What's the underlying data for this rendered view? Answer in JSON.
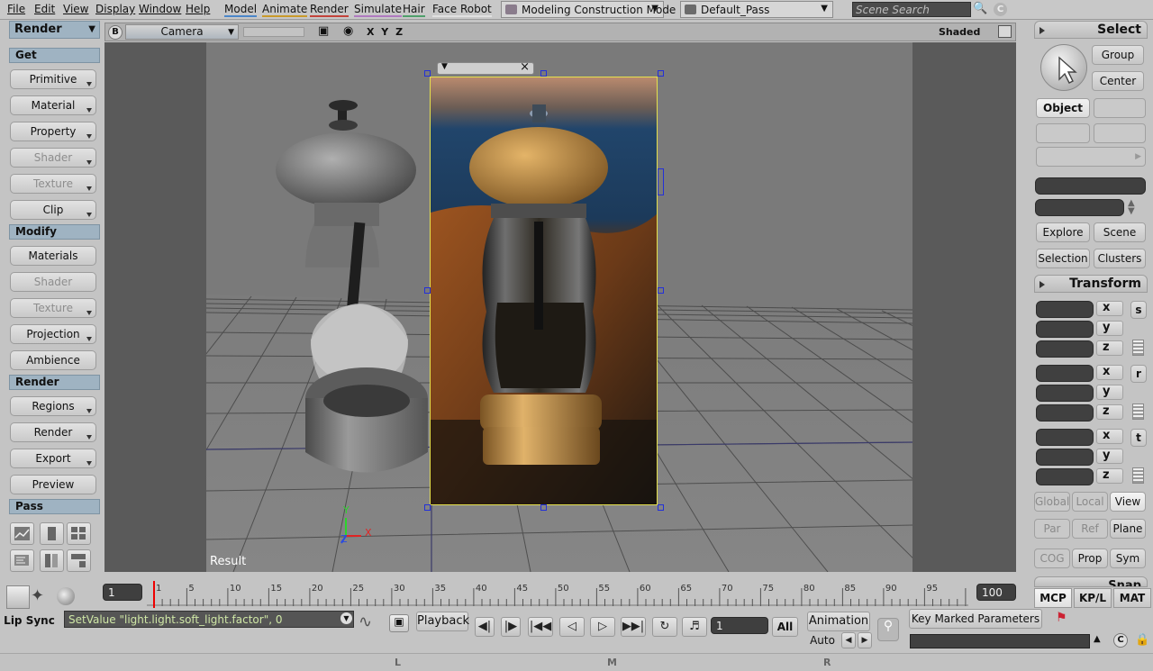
{
  "menubar": {
    "items": [
      "File",
      "Edit",
      "View",
      "Display",
      "Window",
      "Help"
    ],
    "modules": [
      "Model",
      "Animate",
      "Render",
      "Simulate",
      "Hair",
      "Face Robot"
    ],
    "mode": "Modeling Construction Mode",
    "pass": "Default_Pass",
    "search_placeholder": "Scene Search",
    "module_colors": {
      "Model": "#4b86c9",
      "Animate": "#c99a2b",
      "Render": "#c3423a",
      "Simulate": "#b07ac0",
      "Hair": "#4fa06b",
      "Face Robot": "#e0e0e0"
    }
  },
  "left_panel": {
    "title": "Render",
    "sections": [
      {
        "header": "Get",
        "buttons": [
          {
            "label": "Primitive",
            "enabled": true,
            "menu": true
          },
          {
            "label": "Material",
            "enabled": true,
            "menu": true
          },
          {
            "label": "Property",
            "enabled": true,
            "menu": true
          },
          {
            "label": "Shader",
            "enabled": false,
            "menu": true
          },
          {
            "label": "Texture",
            "enabled": false,
            "menu": true
          },
          {
            "label": "Clip",
            "enabled": true,
            "menu": true
          }
        ]
      },
      {
        "header": "Modify",
        "buttons": [
          {
            "label": "Materials",
            "enabled": true,
            "menu": false
          },
          {
            "label": "Shader",
            "enabled": false,
            "menu": false
          },
          {
            "label": "Texture",
            "enabled": false,
            "menu": true
          },
          {
            "label": "Projection",
            "enabled": true,
            "menu": true
          },
          {
            "label": "Ambience",
            "enabled": true,
            "menu": false
          }
        ]
      },
      {
        "header": "Render",
        "buttons": [
          {
            "label": "Regions",
            "enabled": true,
            "menu": true
          },
          {
            "label": "Render",
            "enabled": true,
            "menu": true
          },
          {
            "label": "Export",
            "enabled": true,
            "menu": true
          },
          {
            "label": "Preview",
            "enabled": true,
            "menu": false
          }
        ]
      },
      {
        "header": "Pass",
        "buttons": []
      }
    ]
  },
  "viewport": {
    "letter": "B",
    "camera": "Camera",
    "axes": "X Y Z",
    "display_mode": "Shaded",
    "result_label": "Result",
    "axis_labels": {
      "x": "X",
      "y": "Y",
      "z": "Z"
    }
  },
  "right_panel": {
    "select": {
      "title": "Select",
      "group": "Group",
      "center": "Center",
      "object": "Object",
      "explore": "Explore",
      "scene": "Scene",
      "selection": "Selection",
      "clusters": "Clusters"
    },
    "transform": {
      "title": "Transform",
      "axes": [
        "x",
        "y",
        "z"
      ],
      "groups": [
        "s",
        "r",
        "t"
      ],
      "global": "Global",
      "local": "Local",
      "view": "View",
      "par": "Par",
      "ref": "Ref",
      "plane": "Plane",
      "cog": "COG",
      "prop": "Prop",
      "sym": "Sym"
    },
    "snap": "Snap",
    "tabs": [
      "MCP",
      "KP/L",
      "MAT"
    ]
  },
  "timeline": {
    "start": "1",
    "end": "100",
    "current": "1",
    "ticks": [
      1,
      5,
      10,
      15,
      20,
      25,
      30,
      35,
      40,
      45,
      50,
      55,
      60,
      65,
      70,
      75,
      80,
      85,
      90,
      95,
      100
    ]
  },
  "bottom": {
    "lip_sync": "Lip Sync",
    "command": "SetValue \"light.light.soft_light.factor\", 0",
    "playback": "Playback",
    "frame": "1",
    "all": "All",
    "animation": "Animation",
    "auto": "Auto",
    "key_marked": "Key Marked Parameters",
    "status_letters": [
      "L",
      "M",
      "R"
    ]
  }
}
